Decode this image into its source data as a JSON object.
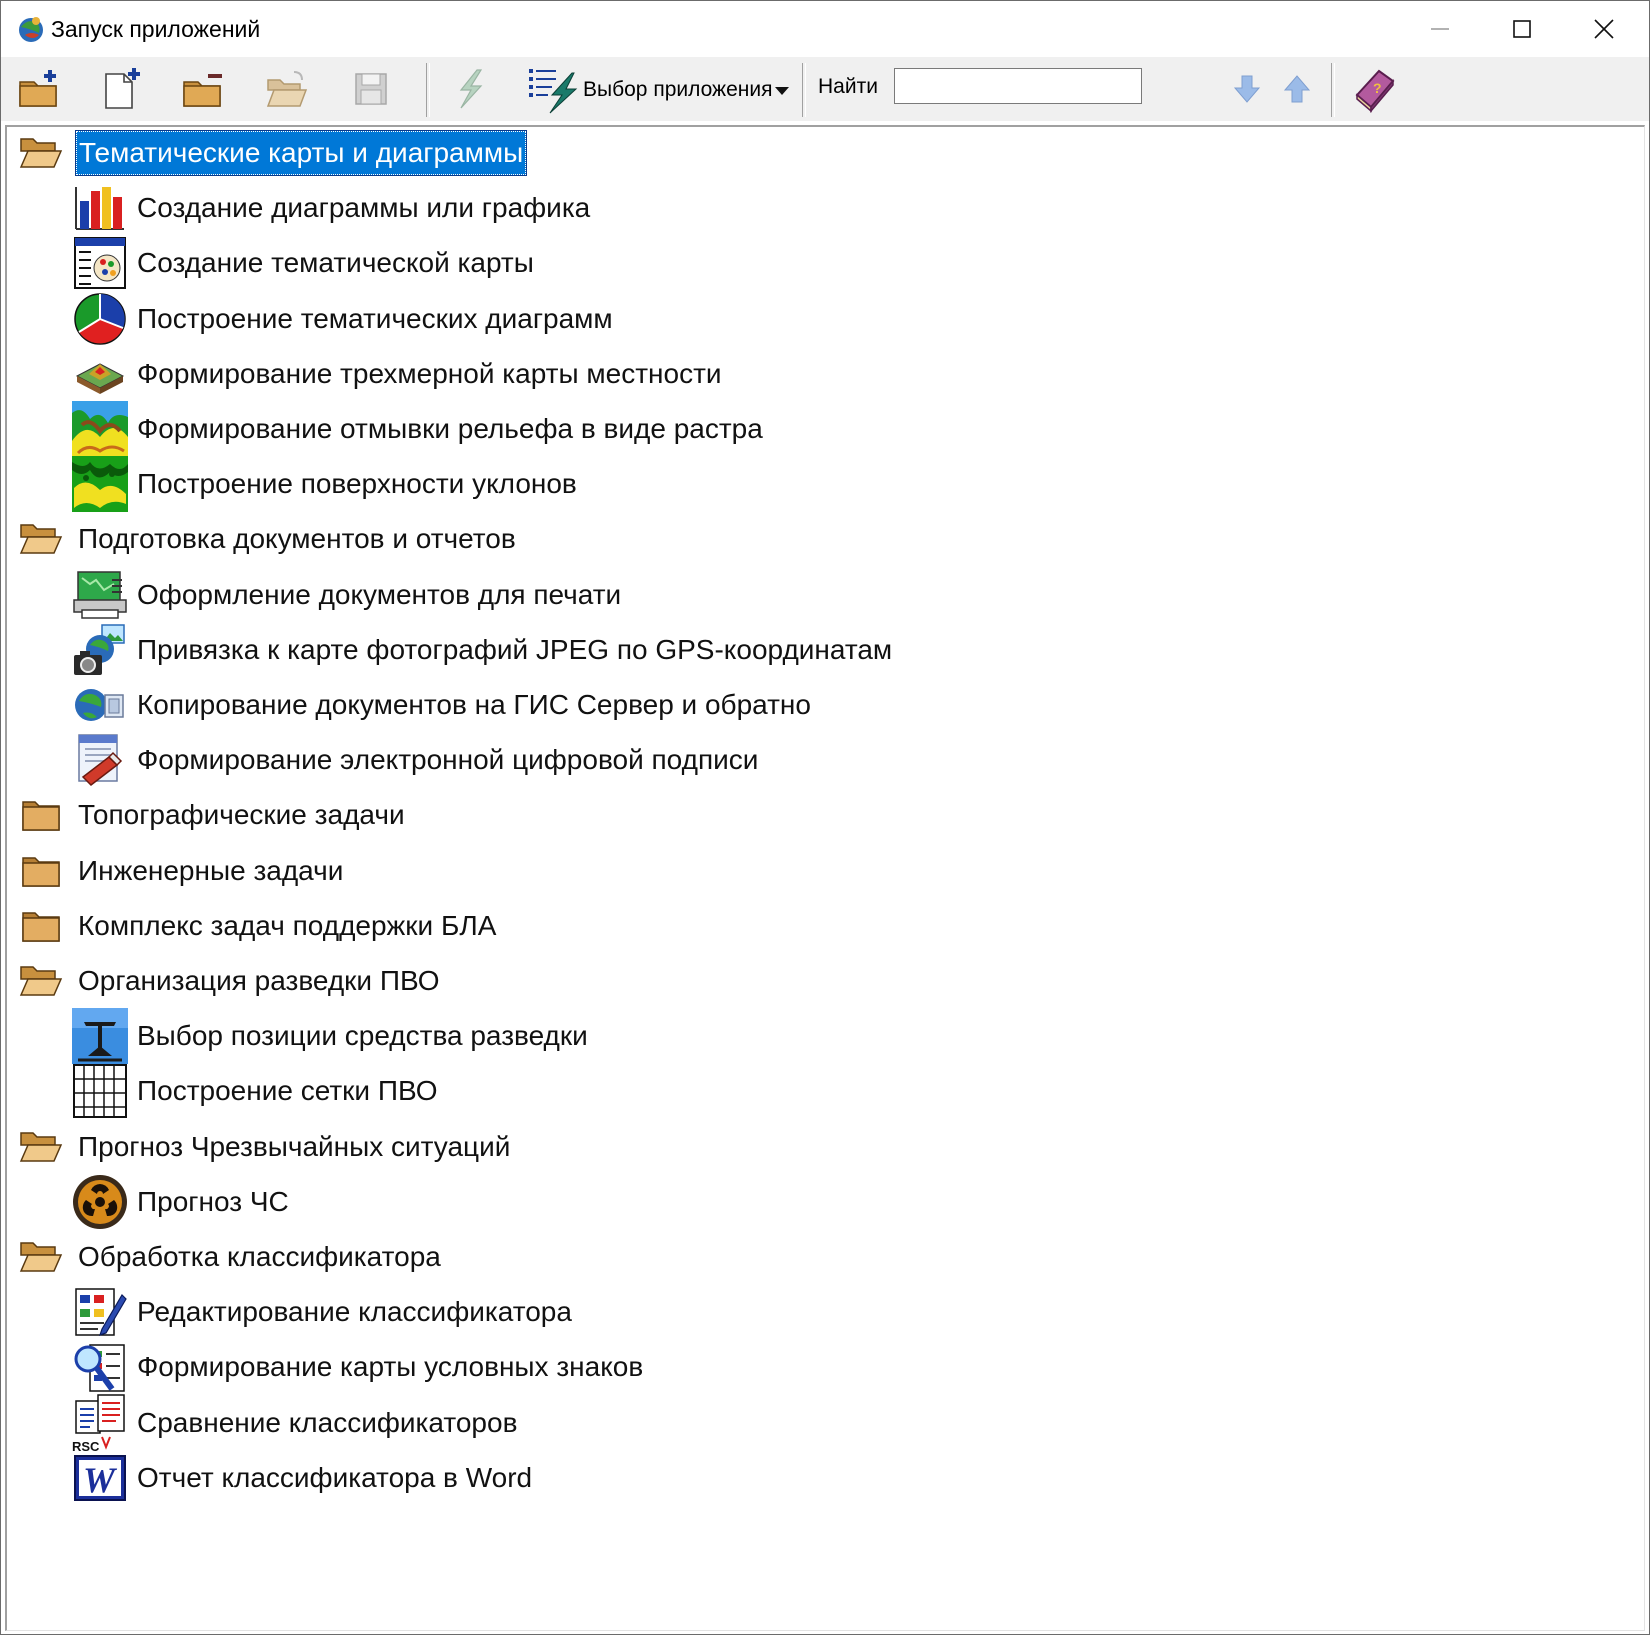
{
  "window": {
    "title": "Запуск приложений"
  },
  "toolbar": {
    "select_app_label": "Выбор приложения",
    "find_label": "Найти",
    "find_value": ""
  },
  "tree": [
    {
      "type": "category",
      "label": "Тематические карты и диаграммы",
      "open": true,
      "selected": true
    },
    {
      "type": "app",
      "label": "Создание диаграммы или графика",
      "icon": "bar-chart-icon"
    },
    {
      "type": "app",
      "label": "Создание тематической карты",
      "icon": "thematic-map-icon"
    },
    {
      "type": "app",
      "label": "Построение тематических диаграмм",
      "icon": "pie-chart-icon"
    },
    {
      "type": "app",
      "label": "Формирование трехмерной карты местности",
      "icon": "3d-terrain-icon"
    },
    {
      "type": "app",
      "label": "Формирование отмывки рельефа в виде растра",
      "icon": "relief-raster-icon"
    },
    {
      "type": "app",
      "label": "Построение поверхности уклонов",
      "icon": "slope-surface-icon"
    },
    {
      "type": "category",
      "label": "Подготовка документов и отчетов",
      "open": true
    },
    {
      "type": "app",
      "label": "Оформление документов для печати",
      "icon": "print-layout-icon"
    },
    {
      "type": "app",
      "label": "Привязка к карте фотографий JPEG по GPS-координатам",
      "icon": "photo-gps-icon"
    },
    {
      "type": "app",
      "label": "Копирование документов на ГИС Сервер и обратно",
      "icon": "gis-server-icon"
    },
    {
      "type": "app",
      "label": "Формирование электронной цифровой подписи",
      "icon": "digital-signature-icon"
    },
    {
      "type": "category",
      "label": "Топографические задачи",
      "open": false
    },
    {
      "type": "category",
      "label": "Инженерные задачи",
      "open": false
    },
    {
      "type": "category",
      "label": "Комплекс задач поддержки БЛА",
      "open": false
    },
    {
      "type": "category",
      "label": "Организация разведки ПВО",
      "open": true
    },
    {
      "type": "app",
      "label": "Выбор позиции средства разведки",
      "icon": "radar-position-icon"
    },
    {
      "type": "app",
      "label": "Построение сетки ПВО",
      "icon": "grid-icon"
    },
    {
      "type": "category",
      "label": "Прогноз Чрезвычайных ситуаций",
      "open": true
    },
    {
      "type": "app",
      "label": "Прогноз ЧС",
      "icon": "hazard-icon"
    },
    {
      "type": "category",
      "label": "Обработка классификатора",
      "open": true
    },
    {
      "type": "app",
      "label": "Редактирование классификатора",
      "icon": "classifier-edit-icon"
    },
    {
      "type": "app",
      "label": "Формирование карты условных знаков",
      "icon": "legend-map-icon"
    },
    {
      "type": "app",
      "label": "Сравнение классификаторов",
      "icon": "classifier-compare-icon"
    },
    {
      "type": "app",
      "label": "Отчет классификатора в Word",
      "icon": "word-report-icon"
    }
  ],
  "colors": {
    "selection": "#0078d7",
    "folder": "#d9a45b",
    "toolbar_bg": "#f0f0f0"
  }
}
